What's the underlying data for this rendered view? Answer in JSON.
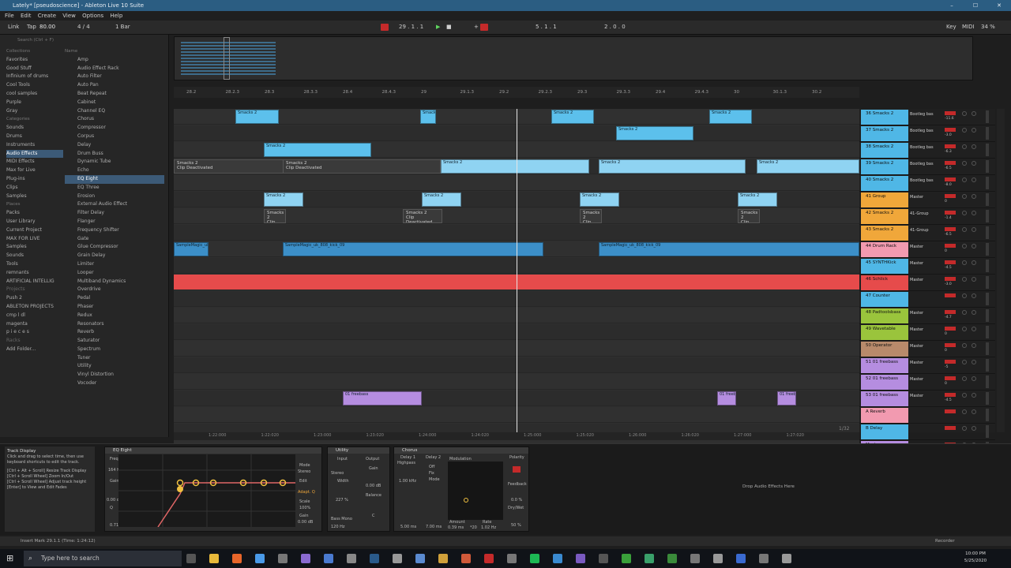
{
  "window": {
    "title": "Lately* [pseudoscience] - Ableton Live 10 Suite",
    "minimize": "–",
    "maximize": "☐",
    "close": "✕"
  },
  "menu": [
    "File",
    "Edit",
    "Create",
    "View",
    "Options",
    "Help"
  ],
  "transport": {
    "link": "Link",
    "tap": "Tap",
    "tempo": "80.00",
    "signature": "4 / 4",
    "quantize": "1 Bar",
    "position": "29 . 1 . 1",
    "loop_start": "5 . 1 . 1",
    "loop_length": "2 . 0 . 0",
    "key": "Key",
    "midi": "MIDI",
    "cpu": "34 %"
  },
  "browser": {
    "search_placeholder": "Search (Ctrl + F)",
    "collections_header": "Collections",
    "collections": [
      "Favorites",
      "Good Stuff",
      "Infinium of drums",
      "Cool Tools",
      "cool samples",
      "Purple",
      "Gray"
    ],
    "categories_header": "Categories",
    "categories": [
      "Sounds",
      "Drums",
      "Instruments",
      "Audio Effects",
      "MIDI Effects",
      "Max for Live",
      "Plug-ins",
      "Clips",
      "Samples"
    ],
    "places_header": "Places",
    "places": [
      "Packs",
      "User Library",
      "Current Project",
      "MAX FOR LIVE",
      "Samples",
      "Sounds",
      "Tools",
      "remnants",
      "ARTIFICIAL INTELLIG",
      "Projects",
      "Push 2",
      "ABLETON PROJECTS",
      "cmp l dl",
      "magenta",
      "p i e c e s",
      "Racks",
      "Add Folder..."
    ],
    "name_header": "Name",
    "items": [
      "Amp",
      "Audio Effect Rack",
      "Auto Filter",
      "Auto Pan",
      "Beat Repeat",
      "Cabinet",
      "Channel EQ",
      "Chorus",
      "Compressor",
      "Corpus",
      "Delay",
      "Drum Buss",
      "Dynamic Tube",
      "Echo",
      "EQ Eight",
      "EQ Three",
      "Erosion",
      "External Audio Effect",
      "Filter Delay",
      "Flanger",
      "Frequency Shifter",
      "Gate",
      "Glue Compressor",
      "Grain Delay",
      "Limiter",
      "Looper",
      "Multiband Dynamics",
      "Overdrive",
      "Pedal",
      "Phaser",
      "Redux",
      "Resonators",
      "Reverb",
      "Saturator",
      "Spectrum",
      "Tuner",
      "Utility",
      "Vinyl Distortion",
      "Vocoder"
    ]
  },
  "ruler_marks": [
    "28.2",
    "28.2.3",
    "28.3",
    "28.3.3",
    "28.4",
    "28.4.3",
    "29",
    "29.1.3",
    "29.2",
    "29.2.3",
    "29.3",
    "29.3.3",
    "29.4",
    "29.4.3",
    "30",
    "30.1.3",
    "30.2"
  ],
  "time_marks": [
    "1:22:000",
    "1:22:020",
    "1:23:000",
    "1:23:020",
    "1:24:000",
    "1:24:020",
    "1:25:000",
    "1:25:020",
    "1:26:000",
    "1:26:020",
    "1:27:000",
    "1:27:020"
  ],
  "zoom_readout": "1/32",
  "clips": {
    "smacks": "Smacks 2",
    "deactivated": "Clip Deactivated",
    "sample_kit": "SampleMagic_uk_808_kick_09",
    "freebass": "01 freebass"
  },
  "tracks": [
    {
      "name": "36 Smacks 2",
      "route": "Bootleg bas",
      "value": "-11.6",
      "color": "#4fb7e6"
    },
    {
      "name": "37 Smacks 2",
      "route": "Bootleg bas",
      "value": "-3.0",
      "color": "#4fb7e6"
    },
    {
      "name": "38 Smacks 2",
      "route": "Bootleg bas",
      "value": "-6.3",
      "color": "#4fb7e6"
    },
    {
      "name": "39 Smacks 2",
      "route": "Bootleg bas",
      "value": "-6.5",
      "color": "#4fb7e6"
    },
    {
      "name": "40 Smacks 2",
      "route": "Bootleg bas",
      "value": "-8.0",
      "color": "#4fb7e6"
    },
    {
      "name": "41 Group",
      "route": "Master",
      "value": "0",
      "color": "#f0a73a"
    },
    {
      "name": "42 Smacks 2",
      "route": "41-Group",
      "value": "-1.4",
      "color": "#f0a73a"
    },
    {
      "name": "43 Smacks 2",
      "route": "41-Group",
      "value": "-6.5",
      "color": "#f0a73a"
    },
    {
      "name": "44 Drum Rack",
      "route": "Master",
      "value": "0",
      "color": "#f29ab0"
    },
    {
      "name": "45 SYNTHKick",
      "route": "Master",
      "value": "-4.5",
      "color": "#4fb7e6"
    },
    {
      "name": "46 Schlick",
      "route": "Master",
      "value": "-3.0",
      "color": "#e64b4b"
    },
    {
      "name": "47 Counter",
      "route": "",
      "value": "",
      "color": "#4fb7e6"
    },
    {
      "name": "48 Padtoolsbass",
      "route": "Master",
      "value": "-4.7",
      "color": "#9ac43c"
    },
    {
      "name": "49 Wavetable",
      "route": "Master",
      "value": "0",
      "color": "#9ac43c"
    },
    {
      "name": "50 Operator",
      "route": "Master",
      "value": "0",
      "color": "#b88a6b"
    },
    {
      "name": "51 01 freebass",
      "route": "Master",
      "value": "-5",
      "color": "#b58de0"
    },
    {
      "name": "52 01 freebass",
      "route": "Master",
      "value": "0",
      "color": "#b58de0"
    },
    {
      "name": "53 01 freebass",
      "route": "Master",
      "value": "-4.5",
      "color": "#b58de0"
    },
    {
      "name": "A Reverb",
      "route": "",
      "value": "",
      "color": "#f29ab0"
    },
    {
      "name": "B Delay",
      "route": "",
      "value": "",
      "color": "#4fb7e6"
    },
    {
      "name": "Master",
      "route": "1/2",
      "value": "0",
      "color": "#b58de0"
    }
  ],
  "info_view": {
    "title": "Track Display",
    "text": "Click and drag to select time, then use keyboard shortcuts to edit the track.",
    "lines": [
      "[Ctrl + Alt + Scroll] Resize Track Display",
      "[Ctrl + Scroll Wheel] Zoom In/Out",
      "[Ctrl + Scroll Wheel] Adjust track height",
      "[Enter] to View and Edit Fades"
    ]
  },
  "devices": {
    "eq": {
      "name": "EQ Eight",
      "freq_label": "Freq",
      "freq": "164 Hz",
      "gain_label": "Gain",
      "gain": "0.00 dB",
      "q_label": "Q",
      "q": "0.71",
      "mode": "Mode",
      "mode_value": "Stereo",
      "edit": "Edit",
      "adapt_q": "Adapt. Q",
      "scale_label": "Scale",
      "scale": "100%",
      "gain_out_label": "Gain",
      "gain_out": "0.00 dB"
    },
    "utility": {
      "name": "Utility",
      "input": "Input",
      "output": "Output",
      "stereo": "Stereo",
      "width": "Width",
      "width_value": "227 %",
      "gain": "Gain",
      "gain_value": "0.00 dB",
      "balance": "Balance",
      "balance_value": "C",
      "bass_mono": "Bass Mono",
      "bass_freq": "120 Hz"
    },
    "chorus": {
      "name": "Chorus",
      "delay1": "Delay 1",
      "highpass": "Highpass",
      "delay2": "Delay 2",
      "off": "Off",
      "fix": "Fix",
      "mode": "Mode",
      "hp_freq": "1.00 kHz",
      "d1_time": "5.00 ms",
      "d2_time": "7.00 ms",
      "modulation": "Modulation",
      "amount": "Amount",
      "amount_value": "0.39 ms",
      "rate": "Rate",
      "rate_value": "1.02 Hz",
      "x20": "*20",
      "polarity": "Polarity",
      "feedback": "Feedback",
      "feedback_value": "0.0 %",
      "drywet": "Dry/Wet",
      "drywet_value": "50 %"
    }
  },
  "drop_hint": "Drop Audio Effects Here",
  "status_bar": "Insert Mark 29.1.1 (Time: 1:24:12)",
  "status_right": "Recorder",
  "taskbar": {
    "search_placeholder": "Type here to search",
    "time": "10:00 PM",
    "date": "5/25/2020"
  },
  "colors": {
    "accent": "#4fb7e6",
    "playhead_lane": "#e64b4b",
    "purple": "#b58de0",
    "orange": "#f0a73a"
  }
}
